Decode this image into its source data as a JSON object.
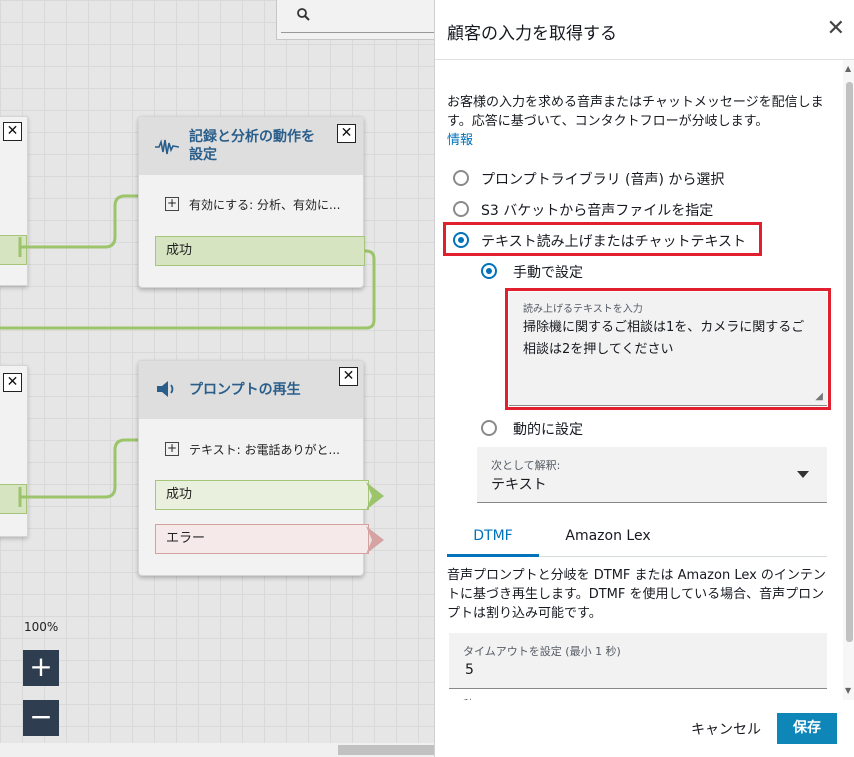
{
  "canvas": {
    "zoom_label": "100%",
    "zoom_in": "+",
    "zoom_out": "−",
    "blocks": [
      {
        "title_line1": "記録と分析の動作を",
        "title_line2": "設定",
        "param": "有効にする: 分析、有効に...",
        "branches": [
          "成功"
        ]
      },
      {
        "title_line1": "プロンプトの再生",
        "param": "テキスト: お電話ありがと...",
        "branches": [
          "成功",
          "エラー"
        ]
      }
    ]
  },
  "panel": {
    "title": "顧客の入力を取得する",
    "description": "お客様の入力を求める音声またはチャットメッセージを配信します。応答に基づいて、コンタクトフローが分岐します。",
    "info_link": "情報",
    "prompt_options": [
      "プロンプトライブラリ (音声) から選択",
      "S3 バケットから音声ファイルを指定",
      "テキスト読み上げまたはチャットテキスト"
    ],
    "selected_option": "テキスト読み上げまたはチャットテキスト",
    "set_manually": "手動で設定",
    "set_dynamically": "動的に設定",
    "text_field": {
      "label": "読み上げるテキストを入力",
      "value": "掃除機に関するご相談は1を、カメラに関するご相談は2を押してください"
    },
    "interpret_as": {
      "label": "次として解釈:",
      "value": "テキスト"
    },
    "tabs": [
      "DTMF",
      "Amazon Lex"
    ],
    "active_tab": "DTMF",
    "tab_description": "音声プロンプトと分岐を DTMF または Amazon Lex のインテントに基づき再生します。DTMF を使用している場合、音声プロンプトは割り込み可能です。",
    "timeout": {
      "label": "タイムアウトを設定 (最小 1 秒)",
      "value": "5"
    },
    "cut_off_label": "秒",
    "cancel_label": "キャンセル",
    "save_label": "保存",
    "close_glyph": "✕"
  },
  "colors": {
    "accent": "#0073bb",
    "highlight": "#e0202f",
    "save_button": "#0f86b8",
    "success_branch": "#a6c47a",
    "error_branch": "#d4a0a0"
  }
}
